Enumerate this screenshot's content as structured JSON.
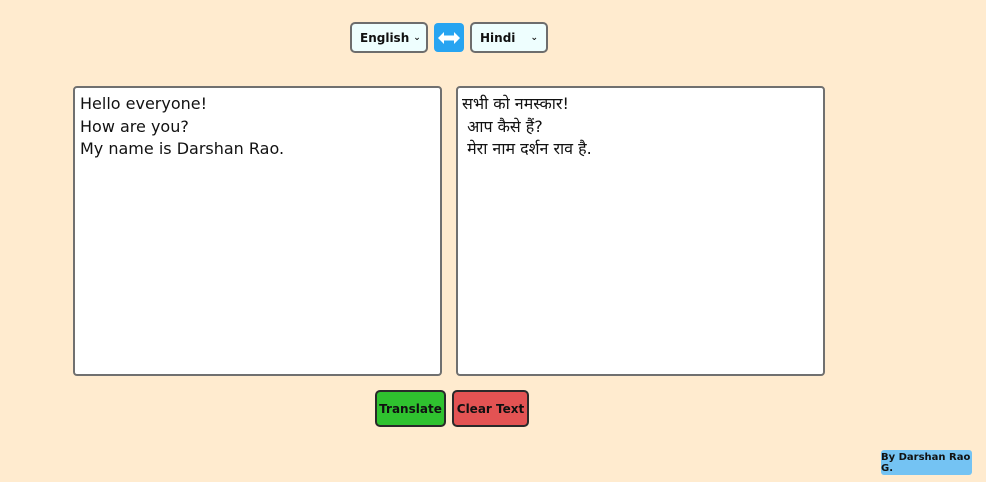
{
  "from_lang": {
    "selected": "English"
  },
  "to_lang": {
    "selected": "Hindi"
  },
  "swap": {
    "icon": "swap-arrows-icon"
  },
  "source": {
    "text": "Hello everyone!\nHow are you?\nMy name is Darshan Rao."
  },
  "target": {
    "text": "सभी को नमस्कार!\n आप कैसे हैं?\n मेरा नाम दर्शन राव है."
  },
  "buttons": {
    "translate_label": "Translate",
    "clear_label": "Clear Text"
  },
  "footer": {
    "credit": "By Darshan Rao G."
  },
  "colors": {
    "background": "#ffebcf",
    "translate_button": "#2fc22f",
    "clear_button": "#e35353",
    "swap_button": "#27a4f1",
    "credit_badge": "#74c3f3"
  }
}
